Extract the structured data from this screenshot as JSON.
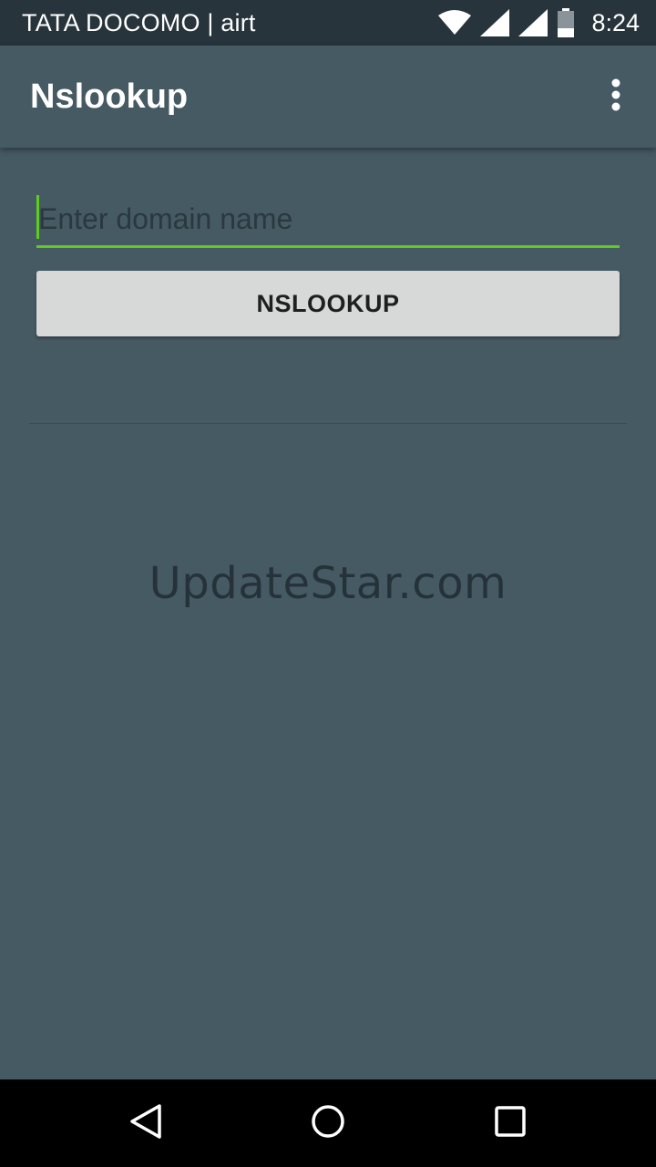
{
  "status_bar": {
    "carrier": "TATA DOCOMO | airt",
    "time": "8:24",
    "icons": [
      "wifi-icon",
      "signal-icon",
      "signal-icon",
      "battery-icon"
    ]
  },
  "app_bar": {
    "title": "Nslookup",
    "overflow_icon": "more-vert-icon"
  },
  "form": {
    "domain_value": "",
    "domain_placeholder": "Enter domain name",
    "button_label": "NSLOOKUP"
  },
  "watermark": "UpdateStar.com",
  "nav_bar": {
    "icons": [
      "back-icon",
      "home-icon",
      "recents-icon"
    ]
  },
  "colors": {
    "background": "#465a64",
    "status_bar": "#27343b",
    "accent": "#5ecb1e",
    "button": "#d7d8d8",
    "nav_bar": "#000000"
  }
}
